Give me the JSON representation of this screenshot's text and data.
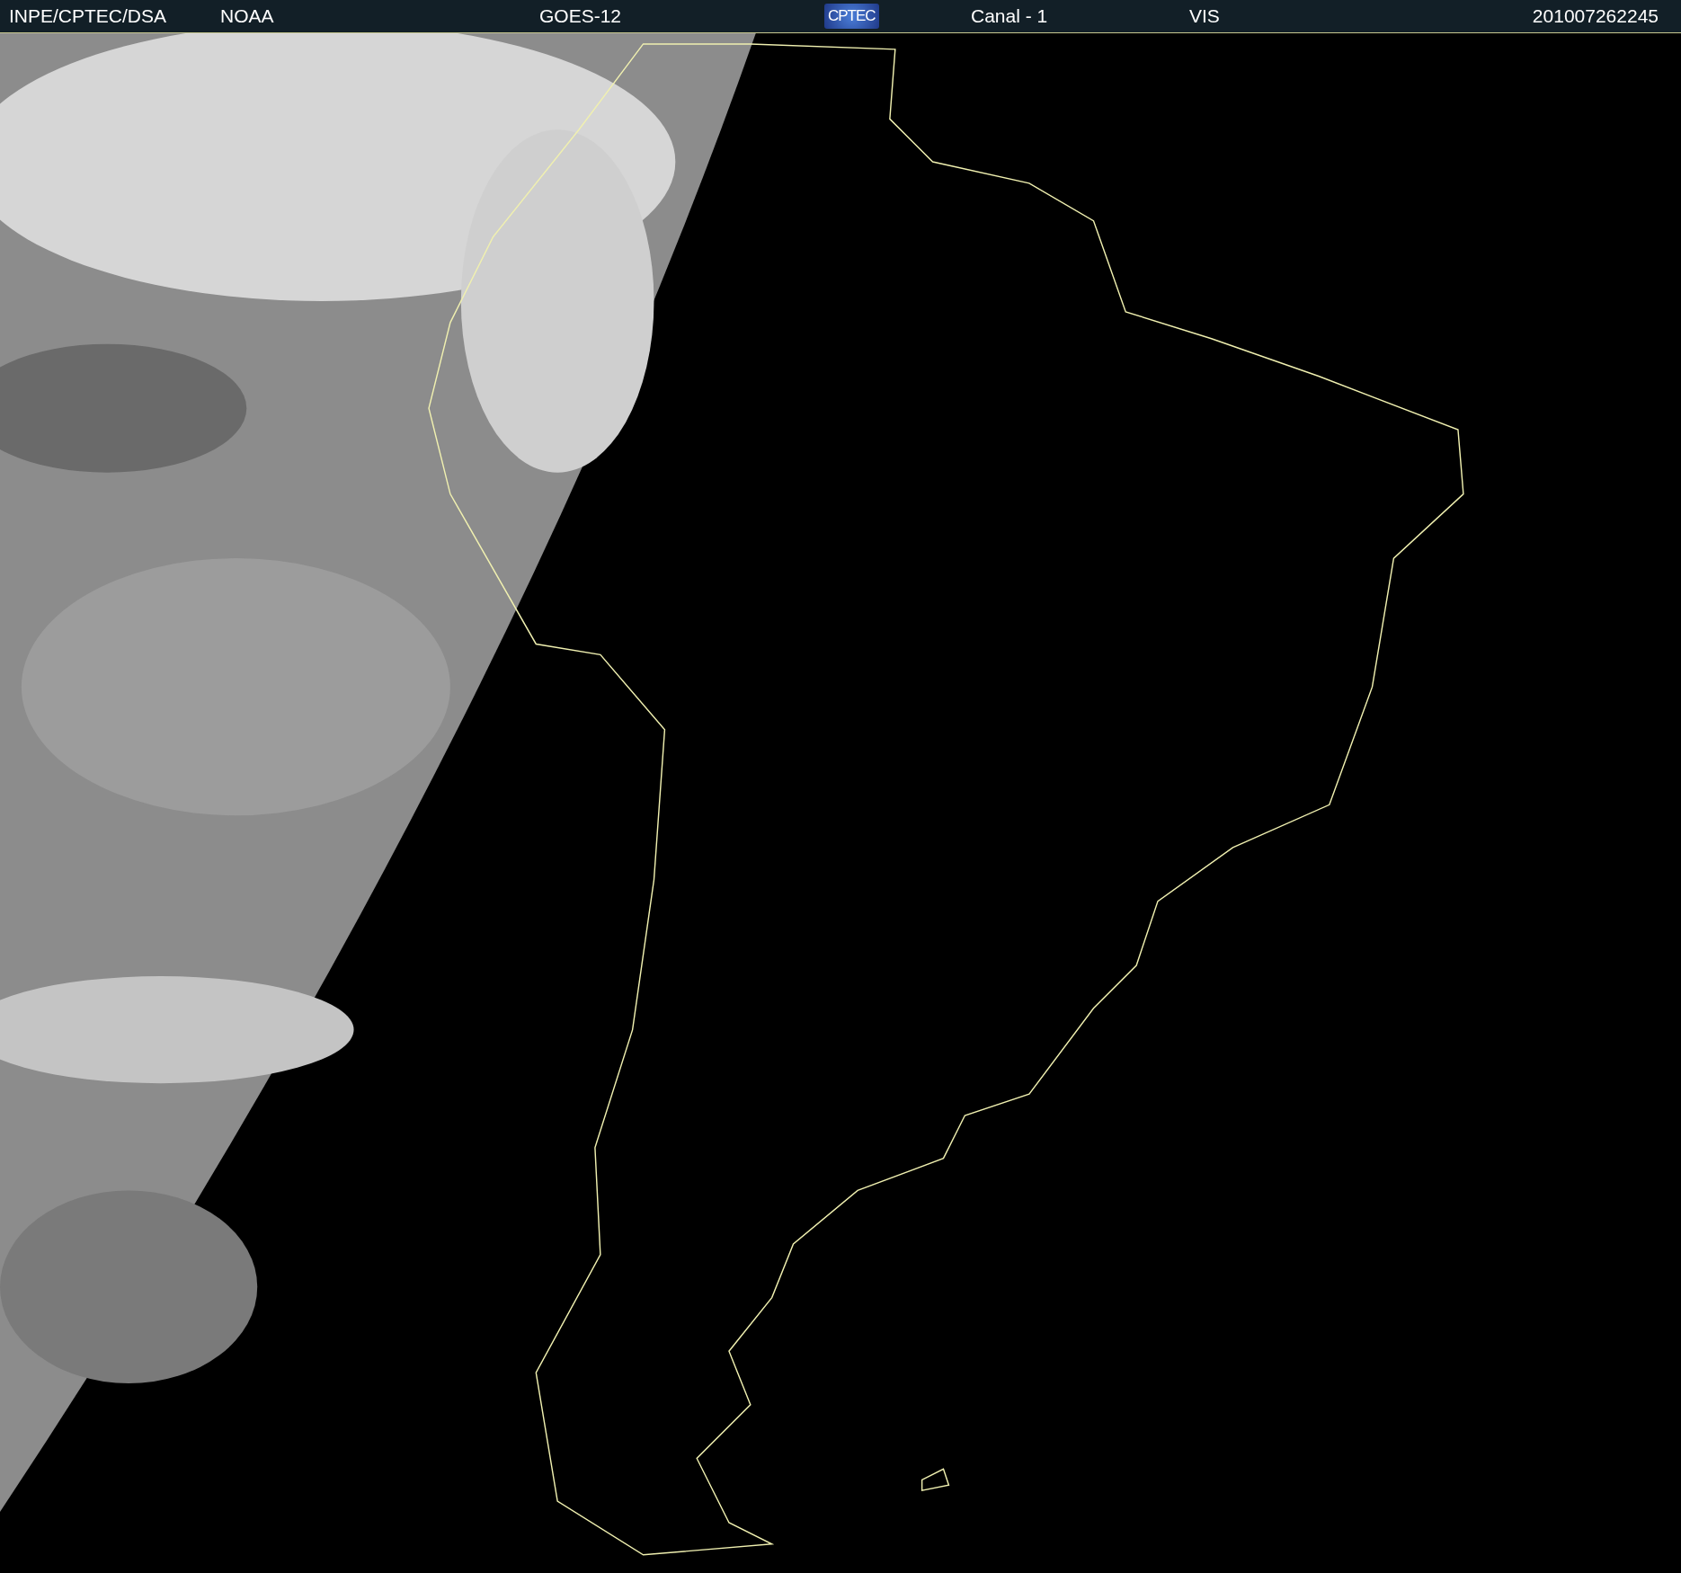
{
  "header": {
    "items": [
      {
        "kind": "text",
        "text": "INPE/CPTEC/DSA"
      },
      {
        "kind": "text",
        "text": "NOAA"
      },
      {
        "kind": "text",
        "text": "GOES-12"
      },
      {
        "kind": "logo",
        "text": "CPTEC"
      },
      {
        "kind": "text",
        "text": "Canal - 1"
      },
      {
        "kind": "text",
        "text": "VIS"
      },
      {
        "kind": "text",
        "text": "201007262245"
      }
    ]
  }
}
